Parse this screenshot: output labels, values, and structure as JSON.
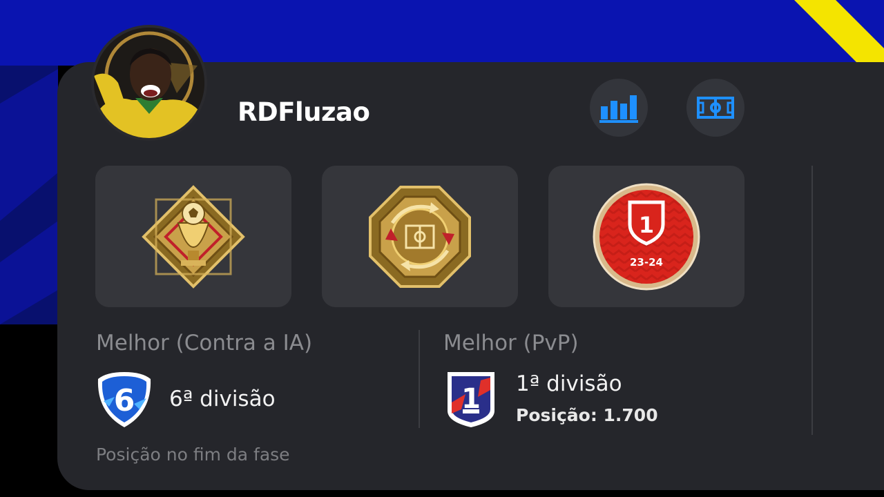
{
  "profile": {
    "username": "RDFluzao",
    "avatar_icon": "player-portrait-icon"
  },
  "actions": {
    "stats_icon": "bar-chart-icon",
    "formation_icon": "pitch-formation-icon"
  },
  "achievements": [
    {
      "icon": "trophy-emblem-icon"
    },
    {
      "icon": "tactics-emblem-icon"
    },
    {
      "icon": "division-1-medal-icon",
      "number": "1",
      "season": "23-24"
    }
  ],
  "best_vs_ai": {
    "label": "Melhor (Contra a IA)",
    "badge_number": "6",
    "division": "6ª divisão"
  },
  "best_pvp": {
    "label": "Melhor (PvP)",
    "badge_number": "1",
    "division": "1ª divisão",
    "position": "Posição: 1.700"
  },
  "footnote": "Posição no fim da fase",
  "colors": {
    "banner_blue": "#0a14b0",
    "banner_yellow": "#f4e400",
    "card_bg": "#25262b",
    "tile_bg": "#35363b",
    "accent_blue": "#1e90ff",
    "gold": "#c9a14a",
    "red": "#d9241c"
  }
}
